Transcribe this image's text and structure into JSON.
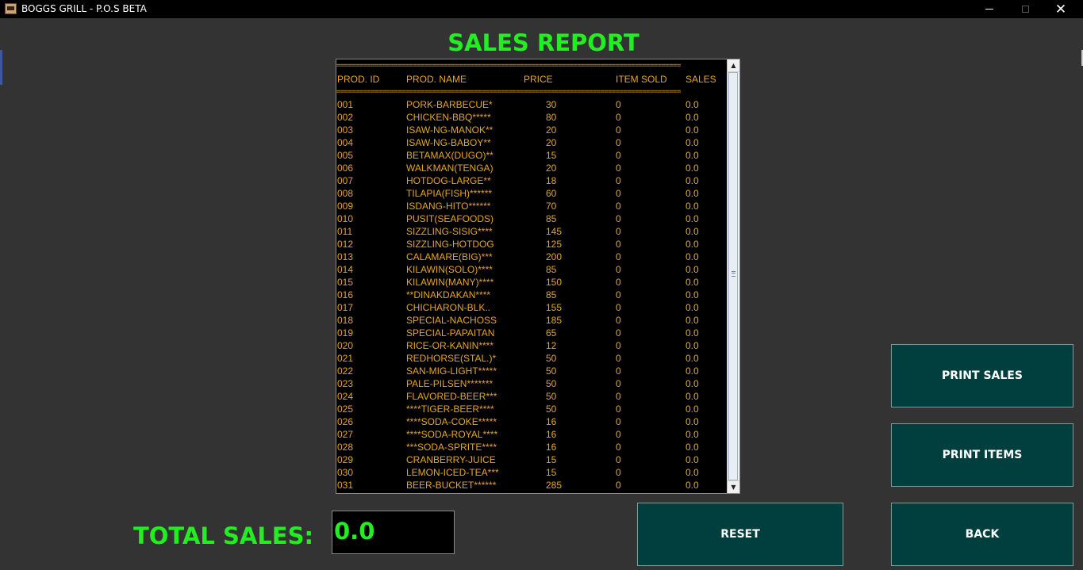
{
  "window": {
    "title": "BOGGS GRILL - P.O.S BETA",
    "controls": {
      "minimize": "–",
      "maximize": "☐",
      "close": "✕"
    }
  },
  "report": {
    "title": "SALES REPORT",
    "separator": "==========================================================================================",
    "headers": {
      "id": "PROD. ID",
      "name": "PROD. NAME",
      "price": "PRICE",
      "sold": "ITEM SOLD",
      "sales": "SALES"
    },
    "rows": [
      {
        "id": "001",
        "name": "PORK-BARBECUE*",
        "price": "30",
        "sold": "0",
        "sales": "0.0"
      },
      {
        "id": "002",
        "name": "CHICKEN-BBQ*****",
        "price": "80",
        "sold": "0",
        "sales": "0.0"
      },
      {
        "id": "003",
        "name": "ISAW-NG-MANOK**",
        "price": "20",
        "sold": "0",
        "sales": "0.0"
      },
      {
        "id": "004",
        "name": "ISAW-NG-BABOY**",
        "price": "20",
        "sold": "0",
        "sales": "0.0"
      },
      {
        "id": "005",
        "name": "BETAMAX(DUGO)**",
        "price": "15",
        "sold": "0",
        "sales": "0.0"
      },
      {
        "id": "006",
        "name": "WALKMAN(TENGA)",
        "price": "20",
        "sold": "0",
        "sales": "0.0"
      },
      {
        "id": "007",
        "name": "HOTDOG-LARGE**",
        "price": "18",
        "sold": "0",
        "sales": "0.0"
      },
      {
        "id": "008",
        "name": "TILAPIA(FISH)******",
        "price": "60",
        "sold": "0",
        "sales": "0.0"
      },
      {
        "id": "009",
        "name": "ISDANG-HITO******",
        "price": "70",
        "sold": "0",
        "sales": "0.0"
      },
      {
        "id": "010",
        "name": "PUSIT(SEAFOODS)",
        "price": "85",
        "sold": "0",
        "sales": "0.0"
      },
      {
        "id": "011",
        "name": "SIZZLING-SISIG****",
        "price": "145",
        "sold": "0",
        "sales": "0.0"
      },
      {
        "id": "012",
        "name": "SIZZLING-HOTDOG",
        "price": "125",
        "sold": "0",
        "sales": "0.0"
      },
      {
        "id": "013",
        "name": "CALAMARE(BIG)***",
        "price": "200",
        "sold": "0",
        "sales": "0.0"
      },
      {
        "id": "014",
        "name": "KILAWIN(SOLO)****",
        "price": "85",
        "sold": "0",
        "sales": "0.0"
      },
      {
        "id": "015",
        "name": "KILAWIN(MANY)****",
        "price": "150",
        "sold": "0",
        "sales": "0.0"
      },
      {
        "id": "016",
        "name": "**DINAKDAKAN****",
        "price": "85",
        "sold": "0",
        "sales": "0.0"
      },
      {
        "id": "017",
        "name": "CHICHARON-BLK..",
        "price": "155",
        "sold": "0",
        "sales": "0.0"
      },
      {
        "id": "018",
        "name": "SPECIAL-NACHOSS",
        "price": "185",
        "sold": "0",
        "sales": "0.0"
      },
      {
        "id": "019",
        "name": "SPECIAL-PAPAITAN",
        "price": "65",
        "sold": "0",
        "sales": "0.0"
      },
      {
        "id": "020",
        "name": "RICE-OR-KANIN****",
        "price": "12",
        "sold": "0",
        "sales": "0.0"
      },
      {
        "id": "021",
        "name": "REDHORSE(STAL.)*",
        "price": "50",
        "sold": "0",
        "sales": "0.0"
      },
      {
        "id": "022",
        "name": "SAN-MIG-LIGHT*****",
        "price": "50",
        "sold": "0",
        "sales": "0.0"
      },
      {
        "id": "023",
        "name": "PALE-PILSEN*******",
        "price": "50",
        "sold": "0",
        "sales": "0.0"
      },
      {
        "id": "024",
        "name": "FLAVORED-BEER***",
        "price": "50",
        "sold": "0",
        "sales": "0.0"
      },
      {
        "id": "025",
        "name": "****TIGER-BEER****",
        "price": "50",
        "sold": "0",
        "sales": "0.0"
      },
      {
        "id": "026",
        "name": "****SODA-COKE*****",
        "price": "16",
        "sold": "0",
        "sales": "0.0"
      },
      {
        "id": "027",
        "name": "****SODA-ROYAL****",
        "price": "16",
        "sold": "0",
        "sales": "0.0"
      },
      {
        "id": "028",
        "name": "***SODA-SPRITE****",
        "price": "16",
        "sold": "0",
        "sales": "0.0"
      },
      {
        "id": "029",
        "name": "CRANBERRY-JUICE",
        "price": "15",
        "sold": "0",
        "sales": "0.0"
      },
      {
        "id": "030",
        "name": "LEMON-ICED-TEA***",
        "price": "15",
        "sold": "0",
        "sales": "0.0"
      },
      {
        "id": "031",
        "name": "BEER-BUCKET******",
        "price": "285",
        "sold": "0",
        "sales": "0.0"
      }
    ]
  },
  "buttons": {
    "print_sales": "PRINT SALES",
    "print_items": "PRINT ITEMS",
    "reset": "RESET",
    "back": "BACK"
  },
  "total": {
    "label": "TOTAL SALES:",
    "value": "0.0"
  },
  "colors": {
    "background": "#333333",
    "accent_green": "#22ee22",
    "report_text": "#e6a623",
    "button_bg": "#013f3f"
  }
}
